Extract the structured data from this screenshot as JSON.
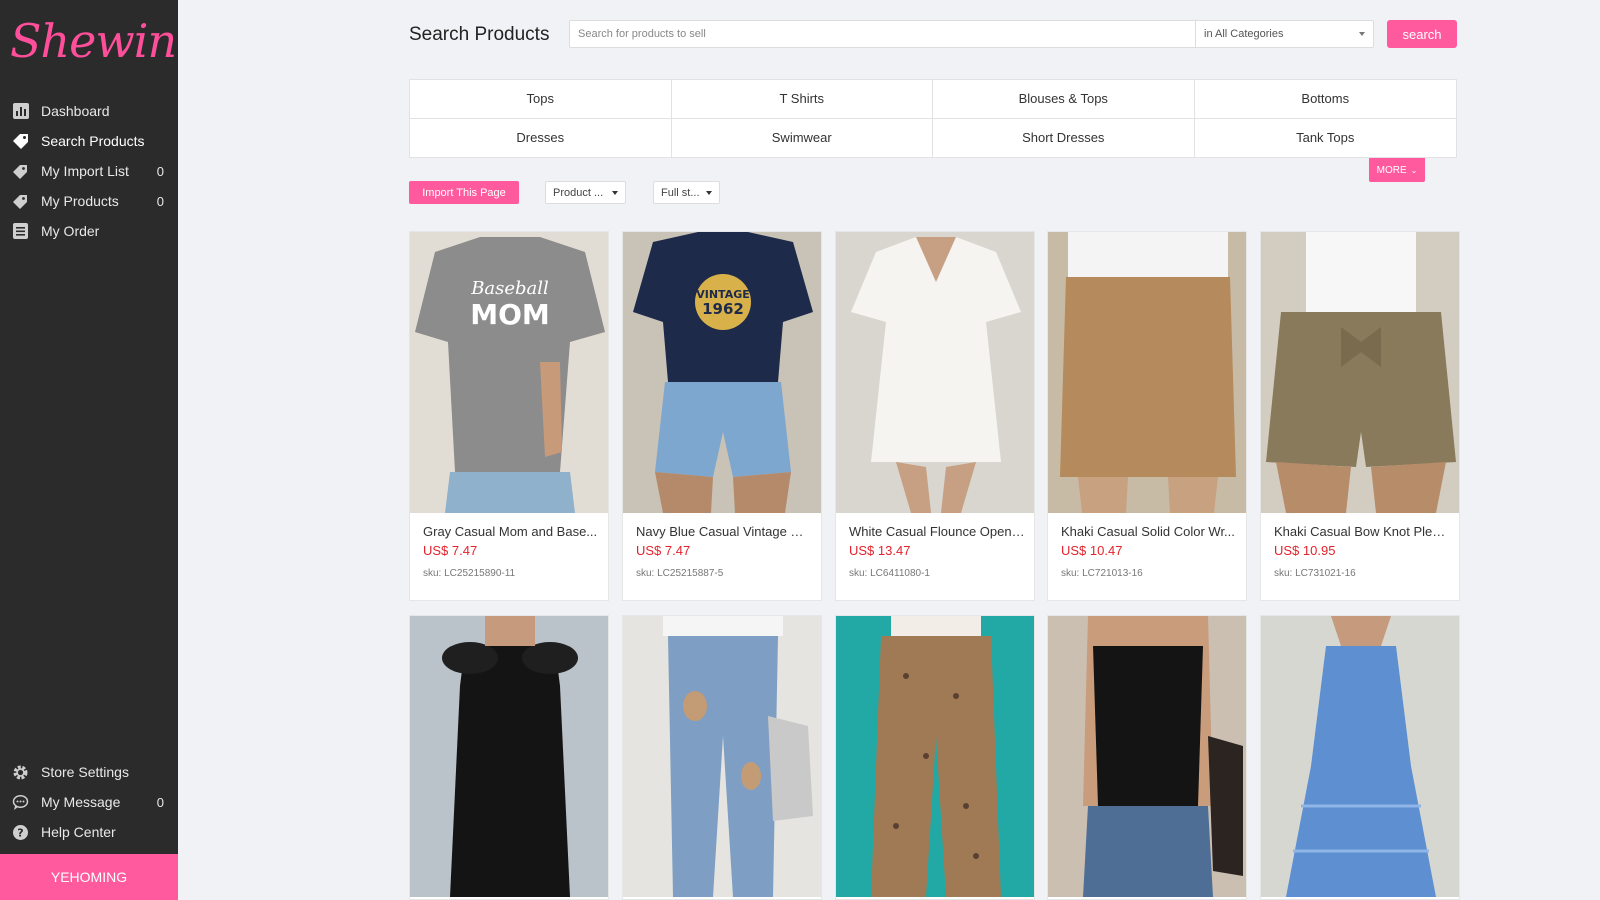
{
  "brand": {
    "logo_text": "Shewin",
    "accent": "#ff5a9e",
    "sidebar_bg": "#2b2b2b",
    "price_color": "#e4222b"
  },
  "sidebar": {
    "items": [
      {
        "label": "Dashboard",
        "icon": "bar-chart-icon",
        "badge": ""
      },
      {
        "label": "Search Products",
        "icon": "tag-icon",
        "badge": "",
        "active": true
      },
      {
        "label": "My Import List",
        "icon": "tags-icon",
        "badge": "0"
      },
      {
        "label": "My Products",
        "icon": "tags-icon",
        "badge": "0"
      },
      {
        "label": "My Order",
        "icon": "list-icon",
        "badge": ""
      }
    ],
    "bottom_items": [
      {
        "label": "Store Settings",
        "icon": "gear-icon",
        "badge": ""
      },
      {
        "label": "My Message",
        "icon": "chat-icon",
        "badge": "0"
      },
      {
        "label": "Help Center",
        "icon": "help-icon",
        "badge": ""
      }
    ],
    "user": "YEHOMING"
  },
  "header": {
    "title": "Search Products",
    "search_placeholder": "Search for products to sell",
    "category_select": "in All Categories",
    "search_button": "search"
  },
  "categories": [
    "Tops",
    "T Shirts",
    "Blouses & Tops",
    "Bottoms",
    "Dresses",
    "Swimwear",
    "Short Dresses",
    "Tank Tops"
  ],
  "more_button": "MORE",
  "toolbar": {
    "import_button": "Import This Page",
    "sort_select": "Product ...",
    "stock_select": "Full st..."
  },
  "products": [
    {
      "name": "Gray Casual Mom and Base...",
      "price": "US$ 7.47",
      "sku": "sku: LC25215890-11"
    },
    {
      "name": "Navy Blue Casual Vintage Sl...",
      "price": "US$ 7.47",
      "sku": "sku: LC25215887-5"
    },
    {
      "name": "White Casual Flounce Open ...",
      "price": "US$ 13.47",
      "sku": "sku: LC6411080-1"
    },
    {
      "name": "Khaki Casual Solid Color Wr...",
      "price": "US$ 10.47",
      "sku": "sku: LC721013-16"
    },
    {
      "name": "Khaki Casual Bow Knot Pleat...",
      "price": "US$ 10.95",
      "sku": "sku: LC731021-16"
    },
    {
      "name": "",
      "price": "",
      "sku": ""
    },
    {
      "name": "",
      "price": "",
      "sku": ""
    },
    {
      "name": "",
      "price": "",
      "sku": ""
    },
    {
      "name": "",
      "price": "",
      "sku": ""
    },
    {
      "name": "",
      "price": "",
      "sku": ""
    }
  ]
}
